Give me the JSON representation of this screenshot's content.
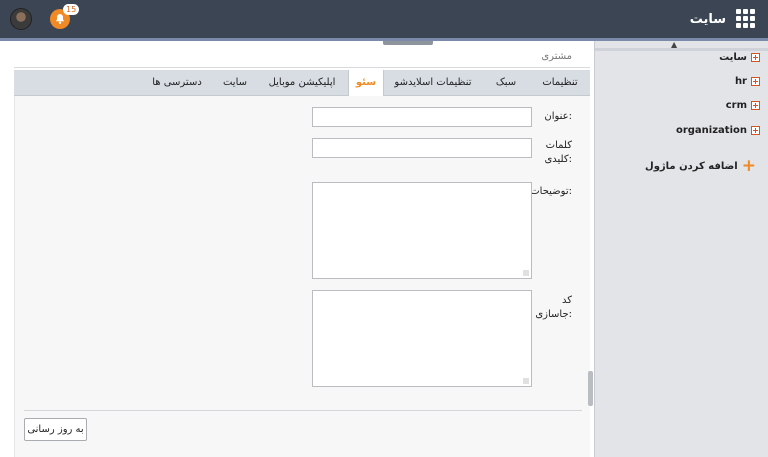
{
  "topbar": {
    "brand_label": "سایت",
    "notification_count": "15"
  },
  "sidebar": {
    "items": [
      {
        "label": "سایت"
      },
      {
        "label": "hr"
      },
      {
        "label": "crm"
      },
      {
        "label": "organization"
      }
    ],
    "add_module_label": "اضافه کردن ماژول"
  },
  "main": {
    "header_label": "مشتری",
    "tabs": [
      {
        "label": "تنظیمات"
      },
      {
        "label": "سبک"
      },
      {
        "label": "تنظیمات اسلایدشو"
      },
      {
        "label": "سئو",
        "active": true
      },
      {
        "label": "اپلیکیشن موبایل"
      },
      {
        "label": "سایت"
      },
      {
        "label": "دسترسی ها"
      }
    ],
    "form": {
      "title_label": "عنوان:",
      "title_value": "",
      "keywords_label_line1": "کلمات",
      "keywords_label_line2": "کلیدی:",
      "keywords_value": "",
      "description_label": "توضیحات:",
      "description_value": "",
      "embed_code_label_line1": "کد",
      "embed_code_label_line2": "جاسازی:",
      "embed_code_value": ""
    },
    "update_button_label": "به روز رسانی"
  },
  "colors": {
    "topbar_bg": "#3c4554",
    "accent_orange": "#f08a24",
    "sidebar_bg": "#e2e4e8",
    "tabbar_bg": "#d8dde4"
  }
}
